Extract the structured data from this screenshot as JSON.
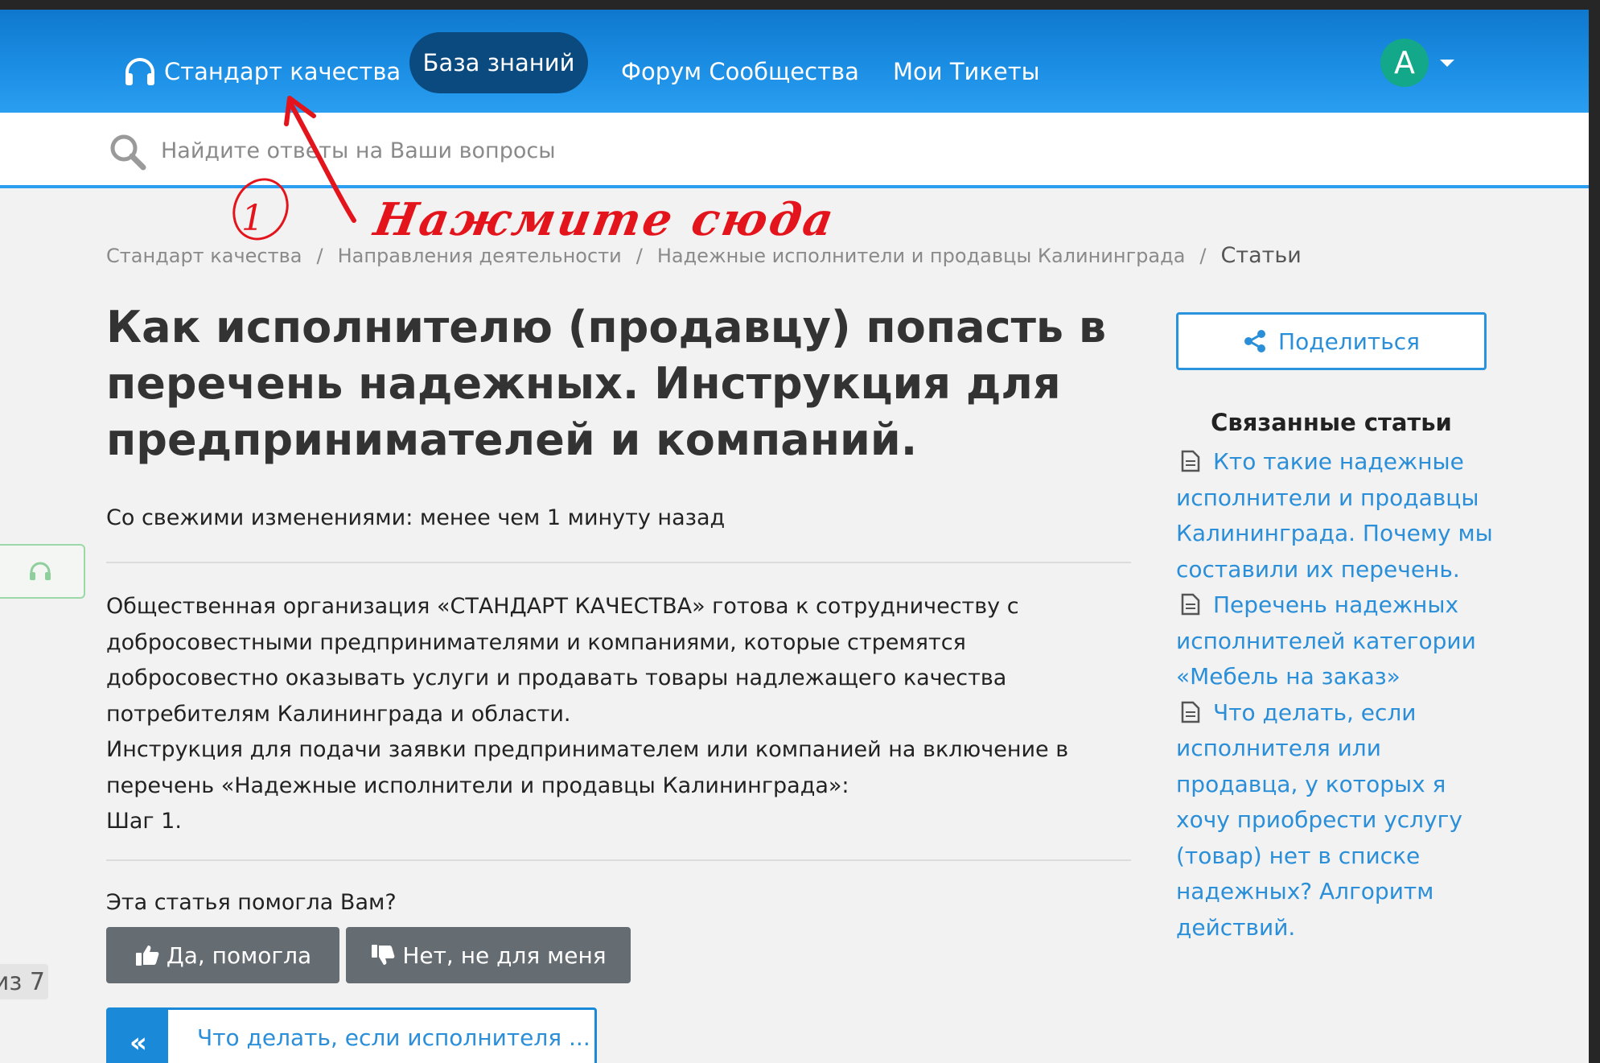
{
  "header": {
    "brand": "Стандарт качества",
    "nav": [
      {
        "label": "База знаний",
        "active": true
      },
      {
        "label": "Форум Сообщества",
        "active": false
      },
      {
        "label": "Мои Тикеты",
        "active": false
      }
    ],
    "avatar_letter": "A",
    "colors": {
      "bar": "#1b8ee4",
      "active_pill": "#0a4a7f",
      "avatar": "#13a88a"
    }
  },
  "search": {
    "placeholder": "Найдите ответы на Ваши вопросы"
  },
  "breadcrumb": [
    "Стандарт качества",
    "Направления деятельности",
    "Надежные исполнители и продавцы Калининграда"
  ],
  "breadcrumb_current": "Статьи",
  "article": {
    "title": "Как исполнителю (продавцу) попасть в перечень надежных. Инструкция для предпринимателей и компаний.",
    "updated": "Со свежими изменениями: менее чем 1 минуту назад",
    "paragraphs": [
      "Общественная организация «СТАНДАРТ КАЧЕСТВА» готова к сотрудничеству с добросовестными предпринимателями и компаниями, которые стремятся добросовестно оказывать услуги и продавать товары надлежащего качества потребителям Калининграда и области.",
      "Инструкция для подачи заявки предпринимателем или компанией на включение в перечень «Надежные исполнители и продавцы Калининграда»:",
      "Шаг 1."
    ],
    "helpful_question": "Эта статья помогла Вам?",
    "helpful_yes": "Да, помогла",
    "helpful_no": "Нет, не для меня",
    "prev_article": "Что делать, если исполнителя ..."
  },
  "sidebar": {
    "share_label": "Поделиться",
    "related_heading": "Связанные статьи",
    "related": [
      "Кто такие надежные исполнители и продавцы Калининграда. Почему мы составили их перечень.",
      "Перечень надежных исполнителей категории «Мебель на заказ»",
      "Что делать, если исполнителя или продавца, у которых я хочу приобрести услугу (товар) нет в списке надежных? Алгоритм действий."
    ]
  },
  "page_counter": "из 7",
  "annotation": {
    "number": "1",
    "text": "Нажмите сюда",
    "color": "#e3141b"
  },
  "icons": [
    "headset-icon",
    "search-icon",
    "share-icon",
    "document-icon",
    "thumbs-up-icon",
    "thumbs-down-icon",
    "double-chevron-left-icon",
    "caret-down-icon"
  ]
}
